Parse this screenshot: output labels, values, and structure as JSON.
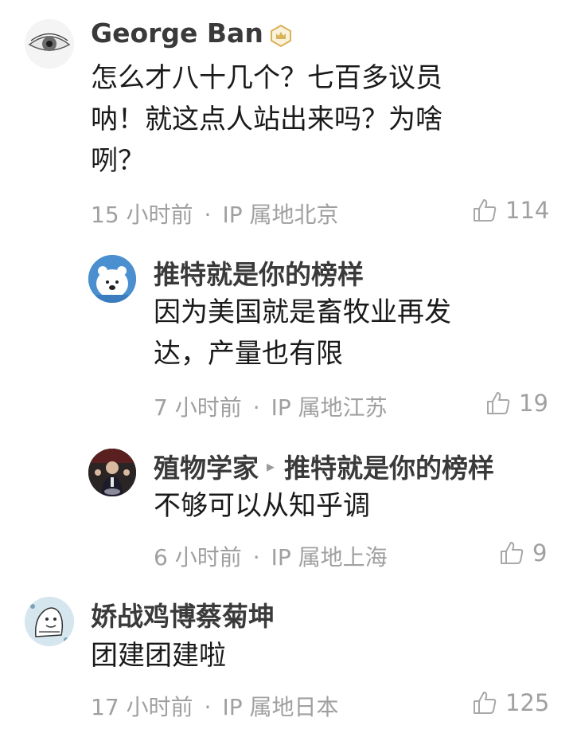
{
  "comments": [
    {
      "author": "George Ban",
      "text_lines": [
        "怎么才八十几个？七百多议员",
        "呐！就这点人站出来吗？为啥",
        "咧？"
      ],
      "time": "15 小时前",
      "location": "IP 属地北京",
      "likes": "114",
      "replies": [
        {
          "author": "推特就是你的榜样",
          "text_lines": [
            "因为美国就是畜牧业再发",
            "达，产量也有限"
          ],
          "time": "7 小时前",
          "location": "IP 属地江苏",
          "likes": "19"
        },
        {
          "author": "殖物学家",
          "reply_to": "推特就是你的榜样",
          "text_lines": [
            "不够可以从知乎调"
          ],
          "time": "6 小时前",
          "location": "IP 属地上海",
          "likes": "9"
        }
      ]
    },
    {
      "author": "娇战鸡博蔡菊坤",
      "text_lines": [
        "团建团建啦"
      ],
      "time": "17 小时前",
      "location": "IP 属地日本",
      "likes": "125"
    }
  ],
  "separator": "·",
  "icons": {
    "badge": "crown-badge-icon",
    "like": "thumbs-up-icon",
    "reply_arrow": "reply-arrow-icon"
  },
  "colors": {
    "badge": "#d8b25a",
    "meta": "#a0a0a0"
  }
}
